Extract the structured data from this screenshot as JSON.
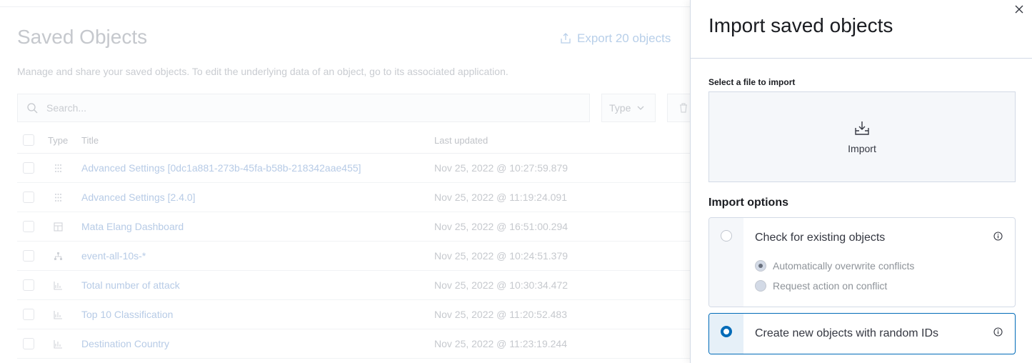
{
  "page": {
    "title": "Saved Objects",
    "export_label": "Export 20 objects",
    "description": "Manage and share your saved objects. To edit the underlying data of an object, go to its associated application.",
    "search_placeholder": "Search...",
    "type_filter_label": "Type"
  },
  "table": {
    "headers": {
      "type": "Type",
      "title": "Title",
      "updated": "Last updated"
    },
    "rows": [
      {
        "icon": "advanced-settings-icon",
        "title": "Advanced Settings [0dc1a881-273b-45fa-b58b-218342aae455]",
        "updated": "Nov 25, 2022 @ 10:27:59.879"
      },
      {
        "icon": "advanced-settings-icon",
        "title": "Advanced Settings [2.4.0]",
        "updated": "Nov 25, 2022 @ 11:19:24.091"
      },
      {
        "icon": "dashboard-icon",
        "title": "Mata Elang Dashboard",
        "updated": "Nov 25, 2022 @ 16:51:00.294"
      },
      {
        "icon": "index-pattern-icon",
        "title": "event-all-10s-*",
        "updated": "Nov 25, 2022 @ 10:24:51.379"
      },
      {
        "icon": "visualization-icon",
        "title": "Total number of attack",
        "updated": "Nov 25, 2022 @ 10:30:34.472"
      },
      {
        "icon": "visualization-icon",
        "title": "Top 10 Classification",
        "updated": "Nov 25, 2022 @ 11:20:52.483"
      },
      {
        "icon": "visualization-icon",
        "title": "Destination Country",
        "updated": "Nov 25, 2022 @ 11:23:19.244"
      }
    ]
  },
  "flyout": {
    "title": "Import saved objects",
    "file_label": "Select a file to import",
    "file_picker_label": "Import",
    "options_title": "Import options",
    "option_check": {
      "label": "Check for existing objects",
      "selected": false,
      "sub_options": [
        {
          "label": "Automatically overwrite conflicts",
          "checked": true
        },
        {
          "label": "Request action on conflict",
          "checked": false
        }
      ]
    },
    "option_create": {
      "label": "Create new objects with random IDs",
      "selected": true
    }
  },
  "colors": {
    "accent": "#006bb8",
    "dimmed_link": "#b7cbe6",
    "border": "#d3dae6"
  }
}
